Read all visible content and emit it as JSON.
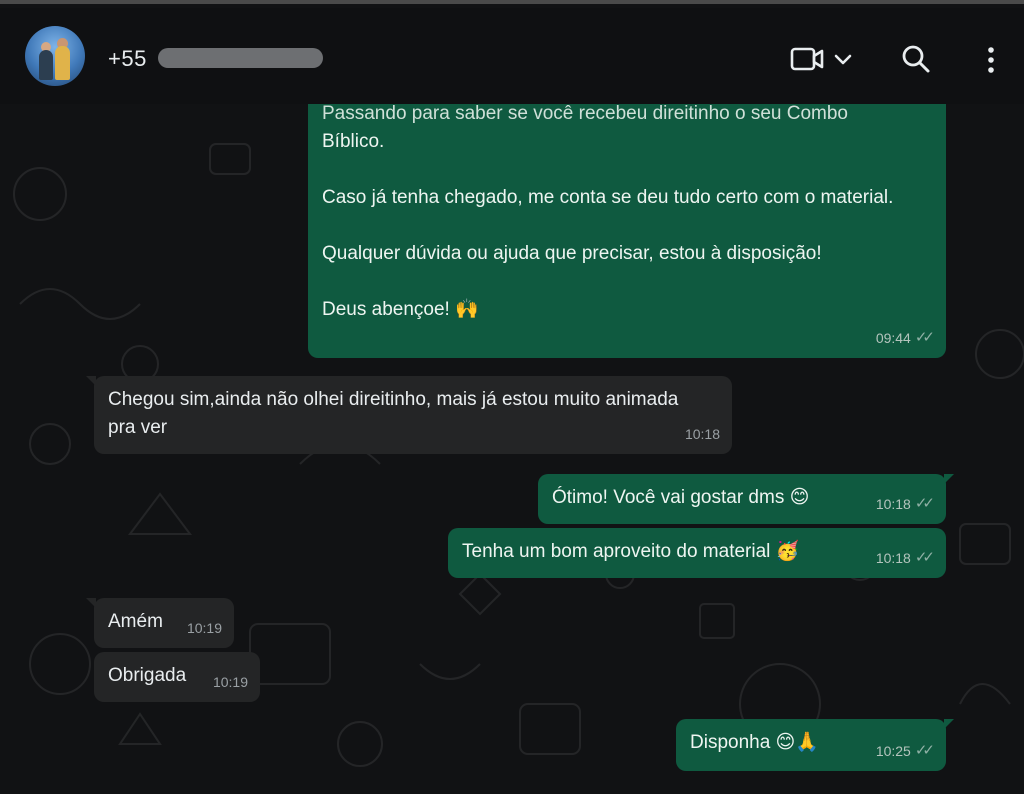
{
  "header": {
    "contact_prefix": "+55",
    "icons": [
      "video-call-icon",
      "chevron-down-icon",
      "search-icon",
      "more-menu-icon"
    ]
  },
  "messages": [
    {
      "direction": "outgoing",
      "cut_line": "Passando para saber se você recebeu direitinho o seu Combo",
      "lines": [
        "Bíblico."
      ],
      "p2": "Caso já tenha chegado, me conta se deu tudo certo com o material.",
      "p3": "Qualquer dúvida ou ajuda que precisar, estou à disposição!",
      "p4": "Deus abençoe! 🙌",
      "time": "09:44"
    },
    {
      "direction": "incoming",
      "text": "Chegou sim,ainda não olhei direitinho, mais já estou muito animada pra ver",
      "time": "10:18"
    },
    {
      "direction": "outgoing",
      "text": "Ótimo! Você vai gostar dms 😊",
      "time": "10:18"
    },
    {
      "direction": "outgoing",
      "text": "Tenha um bom aproveito do material 🥳",
      "time": "10:18"
    },
    {
      "direction": "incoming",
      "text": "Amém",
      "time": "10:19"
    },
    {
      "direction": "incoming",
      "text": "Obrigada",
      "time": "10:19"
    },
    {
      "direction": "outgoing",
      "text": "Disponha 😊🙏",
      "time": "10:25"
    }
  ],
  "colors": {
    "outgoing_bubble": "#0f5a40",
    "incoming_bubble": "#242526",
    "background": "#111214"
  }
}
